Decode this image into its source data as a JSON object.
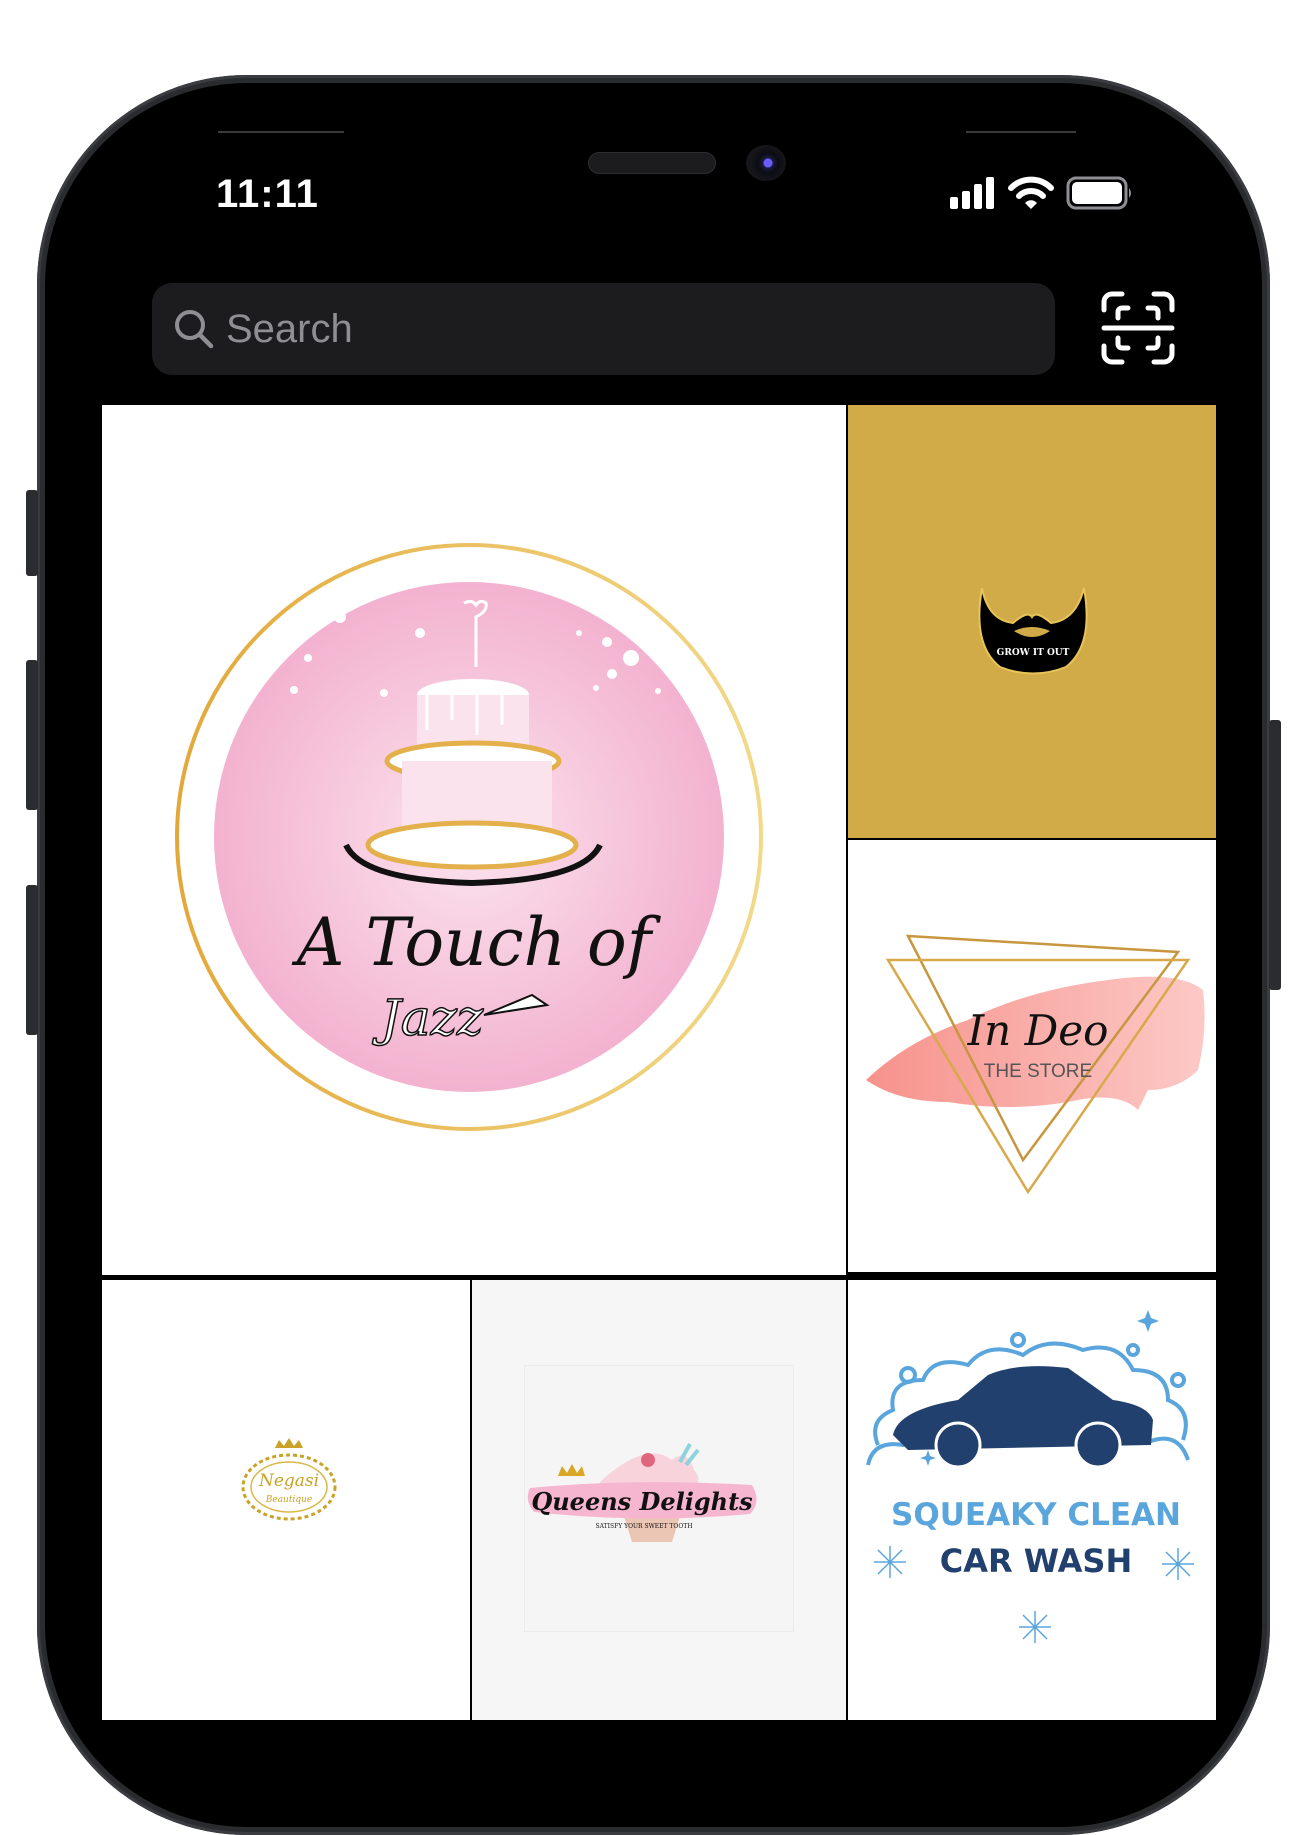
{
  "status_bar": {
    "time": "11:11",
    "signal_icon": "cellular-signal-icon",
    "wifi_icon": "wifi-icon",
    "battery_icon": "battery-icon"
  },
  "search": {
    "placeholder": "Search",
    "value": "",
    "icon": "search-icon"
  },
  "scan_button": {
    "icon": "scan-text-icon"
  },
  "grid": {
    "tiles": [
      {
        "name": "A Touch of Jazz",
        "line1": "A Touch of",
        "line2": "Jazz",
        "background": "#ffffff",
        "accent": "#f4b8d2",
        "ring": "#e3b04b"
      },
      {
        "name": "Grow It Out",
        "line1": "GROW IT OUT",
        "background": "#d1ab47",
        "accent": "#000000"
      },
      {
        "name": "In Deo The Store",
        "line1": "In Deo",
        "line2": "THE STORE",
        "background": "#ffffff",
        "accent": "#f7a3a0",
        "ring": "#c8963e"
      },
      {
        "name": "Negasi Beautique",
        "line1": "Negasi",
        "line2": "Beautique",
        "background": "#ffffff",
        "accent": "#c9a227"
      },
      {
        "name": "Queens Delights",
        "line1": "Queens Delights",
        "line2": "SATISFY YOUR SWEET TOOTH",
        "background": "#f6f6f6",
        "accent": "#f6b6cf"
      },
      {
        "name": "Squeaky Clean Car Wash",
        "line1": "SQUEAKY CLEAN",
        "line2": "CAR WASH",
        "background": "#ffffff",
        "accent": "#5aa5dc",
        "secondary": "#22406e"
      }
    ]
  }
}
